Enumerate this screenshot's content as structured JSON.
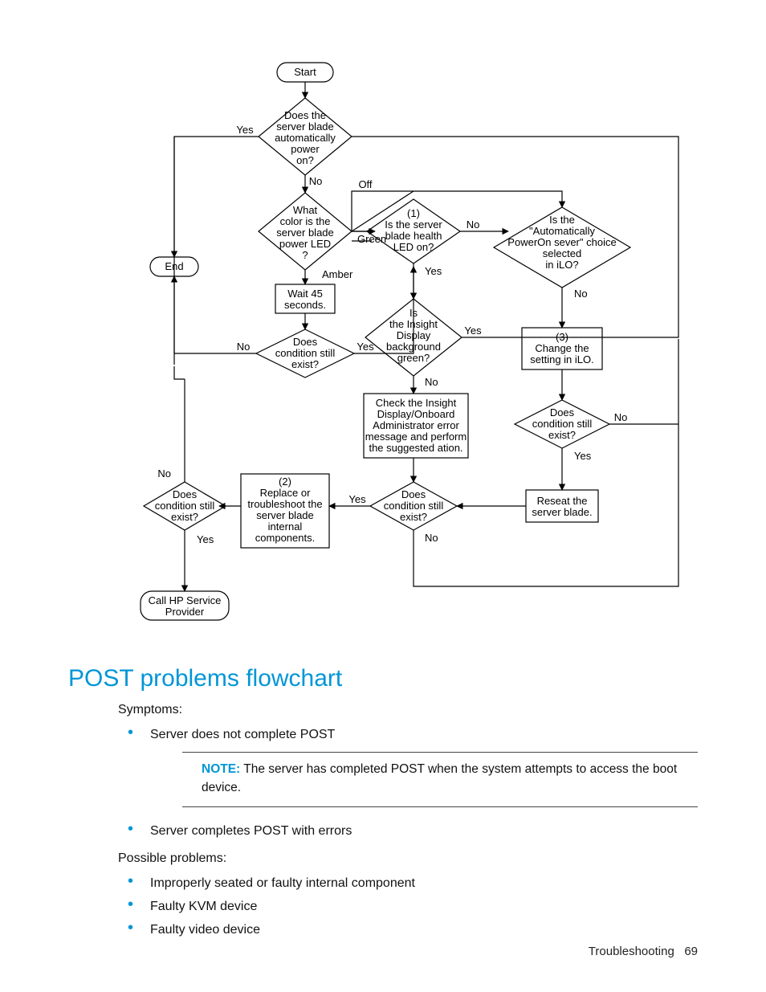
{
  "heading": "POST problems flowchart",
  "symptoms_label": "Symptoms:",
  "symptoms": [
    "Server does not complete POST",
    "Server completes POST with errors"
  ],
  "note": {
    "label": "NOTE:",
    "text": "The server has completed POST when the system attempts to access the boot device."
  },
  "possible_label": "Possible problems:",
  "possible": [
    "Improperly seated or faulty internal component",
    "Faulty KVM device",
    "Faulty video device"
  ],
  "footer": {
    "section": "Troubleshooting",
    "page": "69"
  },
  "flowchart": {
    "nodes": {
      "start": "Start",
      "end": "End",
      "callhp_l1": "Call HP Service",
      "callhp_l2": "Provider",
      "d_auto_l1": "Does the",
      "d_auto_l2": "server blade",
      "d_auto_l3": "automatically",
      "d_auto_l4": "power",
      "d_auto_l5": "on?",
      "d_color_l1": "What",
      "d_color_l2": "color is the",
      "d_color_l3": "server blade",
      "d_color_l4": "power LED",
      "d_color_l5": "?",
      "wait_l1": "Wait 45",
      "wait_l2": "seconds.",
      "d_cond_left_l1": "Does",
      "d_cond_left_l2": "condition still",
      "d_cond_left_l3": "exist?",
      "d_health_l1": "(1)",
      "d_health_l2": "Is the server",
      "d_health_l3": "blade health",
      "d_health_l4": "LED on?",
      "d_ilo_l1": "Is the",
      "d_ilo_l2": "\"Automatically",
      "d_ilo_l3": "PowerOn sever\" choice",
      "d_ilo_l4": "selected",
      "d_ilo_l5": "in iLO?",
      "d_insight_l1": "Is",
      "d_insight_l2": "the Insight",
      "d_insight_l3": "Display",
      "d_insight_l4": "background",
      "d_insight_l5": "green?",
      "change_l1": "(3)",
      "change_l2": "Change the",
      "change_l3": "setting in iLO.",
      "check_l1": "Check the Insight",
      "check_l2": "Display/Onboard",
      "check_l3": "Administrator error",
      "check_l4": "message and perform",
      "check_l5": "the suggested ation.",
      "d_cond_r_l1": "Does",
      "d_cond_r_l2": "condition still",
      "d_cond_r_l3": "exist?",
      "reseat_l1": "Reseat the",
      "reseat_l2": "server blade.",
      "d_cond_mid_l1": "Does",
      "d_cond_mid_l2": "condition still",
      "d_cond_mid_l3": "exist?",
      "replace_l1": "(2)",
      "replace_l2": "Replace or",
      "replace_l3": "troubleshoot the",
      "replace_l4": "server blade",
      "replace_l5": "internal",
      "replace_l6": "components.",
      "d_cond_far_l1": "Does",
      "d_cond_far_l2": "condition still",
      "d_cond_far_l3": "exist?"
    },
    "labels": {
      "yes": "Yes",
      "no": "No",
      "off": "Off",
      "green": "Green",
      "amber": "Amber"
    }
  }
}
